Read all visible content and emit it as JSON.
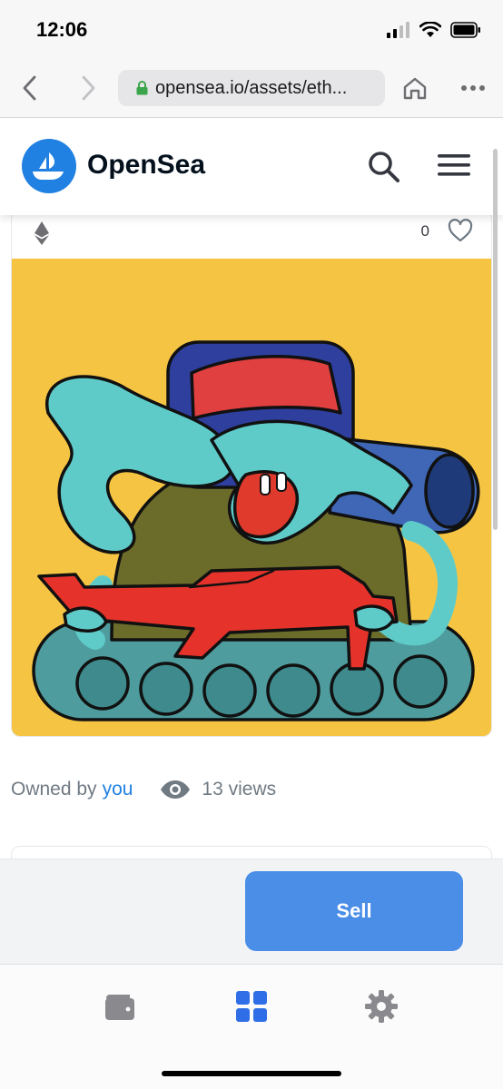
{
  "status_bar": {
    "time": "12:06"
  },
  "browser": {
    "url": "opensea.io/assets/eth..."
  },
  "header": {
    "brand": "OpenSea"
  },
  "asset": {
    "favorites_count": "0"
  },
  "owner": {
    "prefix": "Owned by",
    "name": "you",
    "views": "13 views"
  },
  "actions": {
    "sell_label": "Sell"
  },
  "icons": {
    "back": "chevron-left-icon",
    "forward": "chevron-right-icon",
    "lock": "lock-icon",
    "home": "home-icon",
    "more": "more-icon",
    "search": "search-icon",
    "menu": "hamburger-menu-icon",
    "eth": "ethereum-icon",
    "heart": "heart-icon",
    "eye": "eye-icon",
    "wallet": "wallet-icon",
    "grid": "grid-icon",
    "settings": "gear-icon"
  },
  "colors": {
    "brand_blue": "#2081e2",
    "sell_button": "#4a8ee8",
    "art_background": "#f6c443",
    "active_tab": "#2f6ee6"
  }
}
